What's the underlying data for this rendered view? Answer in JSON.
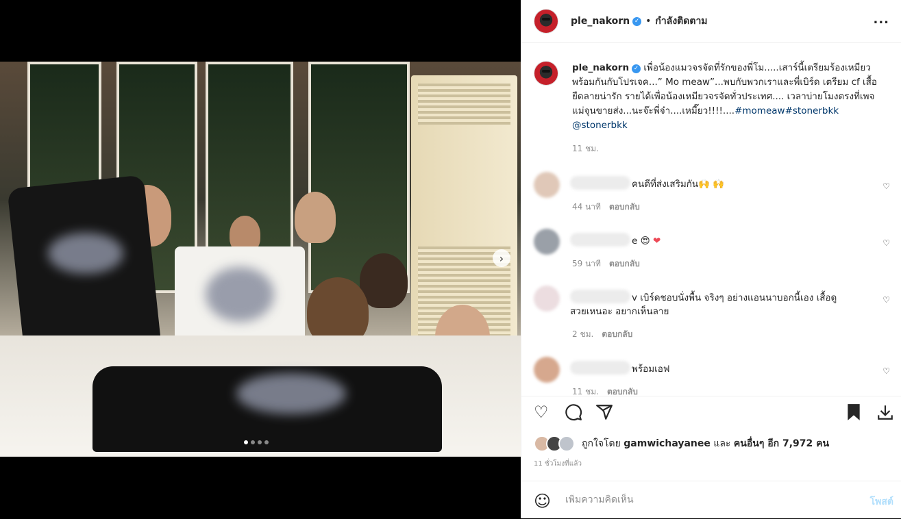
{
  "post": {
    "username": "ple_nakorn",
    "separator": "•",
    "follow_status": "กำลังติดตาม",
    "more": "...",
    "caption_text": "เพื่อน้องแมวจรจัดที่รักของพี่โม.....เสาร์นี้เตรียมร้องเหมียวพร้อมกันกับโปรเจค...” Mo meaw”...พบกับพวกเราและพี่เบิร์ด เตรียม cf เสื้อยืดลายน่ารัก รายได้เพื่อน้องเหมียวจรจัดทั่วประเทศ.... เวลาบ่ายโมงตรงที่เพจแม่จุนขายส่ง...นะจ๊ะพี่จ๋า....เหมี๊ยว!!!!....",
    "hashtags": "#momeaw#stonerbkk",
    "mention": "@stonerbkk",
    "caption_time": "11 ชม."
  },
  "comments": [
    {
      "text": "คนดีที่ส่งเสริมกัน🙌 🙌",
      "time": "44 นาที",
      "reply": "ตอบกลับ"
    },
    {
      "text": "e 😍",
      "heart": "❤",
      "time": "59 นาที",
      "reply": "ตอบกลับ"
    },
    {
      "text": "v เบิร์ดชอบนั่งพื้น จริงๆ อย่างแอนนาบอกนี้เอง เสื้อดูสวยเหนอะ อยากเห็นลาย",
      "time": "2 ชม.",
      "reply": "ตอบกลับ"
    },
    {
      "text": "พร้อมเอฟ",
      "time": "11 ชม.",
      "reply": "ตอบกลับ"
    }
  ],
  "likes": {
    "prefix": "ถูกใจโดย",
    "user": "gamwichayanee",
    "and": "และ",
    "others": "คนอื่นๆ อีก 7,972 คน"
  },
  "posted_ago": "11 ชั่วโมงที่แล้ว",
  "add_comment": {
    "placeholder": "เพิ่มความคิดเห็น",
    "post_label": "โพสต์"
  },
  "icons": {
    "like": "heart-icon",
    "comment": "comment-icon",
    "share": "share-icon",
    "save": "bookmark-icon",
    "download": "download-icon",
    "emoji": "emoji-icon",
    "next": "chevron-right-icon"
  },
  "colors": {
    "link": "#00376b",
    "verified": "#3897f0",
    "post_button": "#b2dffc",
    "heart_red": "#ed4956"
  },
  "carousel": {
    "count": 4,
    "active": 1
  }
}
